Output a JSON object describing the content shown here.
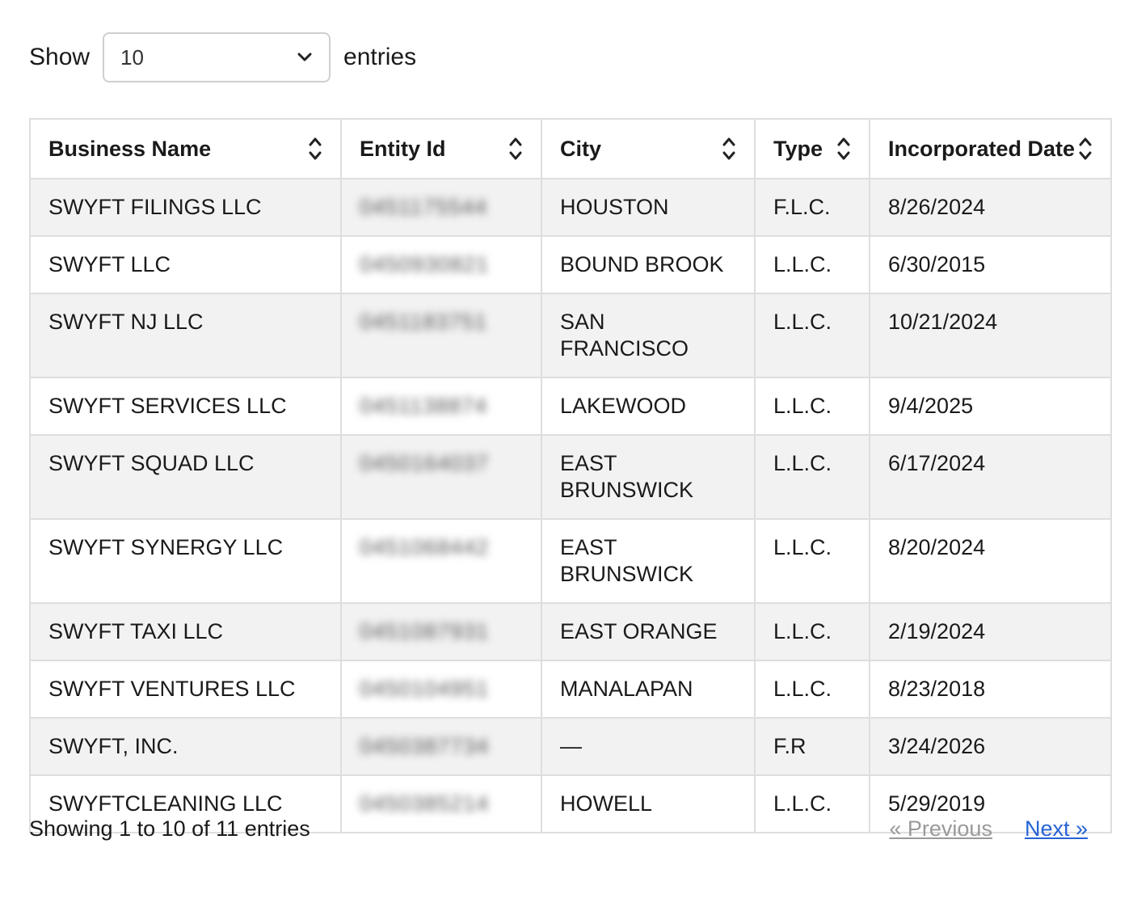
{
  "length_menu": {
    "show_label": "Show",
    "selected": "10",
    "entries_label": "entries"
  },
  "table": {
    "columns": [
      "Business Name",
      "Entity Id",
      "City",
      "Type",
      "Incorporated Date"
    ],
    "rows": [
      {
        "name": "SWYFT FILINGS LLC",
        "entity_id": "0451175544",
        "city": "HOUSTON",
        "type": "F.L.C.",
        "date": "8/26/2024"
      },
      {
        "name": "SWYFT LLC",
        "entity_id": "0450930821",
        "city": "BOUND BROOK",
        "type": "L.L.C.",
        "date": "6/30/2015"
      },
      {
        "name": "SWYFT NJ LLC",
        "entity_id": "0451183751",
        "city": "SAN FRANCISCO",
        "type": "L.L.C.",
        "date": "10/21/2024"
      },
      {
        "name": "SWYFT SERVICES LLC",
        "entity_id": "0451138874",
        "city": "LAKEWOOD",
        "type": "L.L.C.",
        "date": "9/4/2025"
      },
      {
        "name": "SWYFT SQUAD LLC",
        "entity_id": "0450164037",
        "city": "EAST BRUNSWICK",
        "type": "L.L.C.",
        "date": "6/17/2024"
      },
      {
        "name": "SWYFT SYNERGY LLC",
        "entity_id": "0451068442",
        "city": "EAST BRUNSWICK",
        "type": "L.L.C.",
        "date": "8/20/2024"
      },
      {
        "name": "SWYFT TAXI LLC",
        "entity_id": "0451087931",
        "city": "EAST ORANGE",
        "type": "L.L.C.",
        "date": "2/19/2024"
      },
      {
        "name": "SWYFT VENTURES LLC",
        "entity_id": "0450104951",
        "city": "MANALAPAN",
        "type": "L.L.C.",
        "date": "8/23/2018"
      },
      {
        "name": "SWYFT, INC.",
        "entity_id": "0450387734",
        "city": "—",
        "type": "F.R",
        "date": "3/24/2026"
      },
      {
        "name": "SWYFTCLEANING LLC",
        "entity_id": "0450385214",
        "city": "HOWELL",
        "type": "L.L.C.",
        "date": "5/29/2019"
      }
    ]
  },
  "info": "Showing 1 to 10 of 11 entries",
  "pagination": {
    "previous": "« Previous",
    "next": "Next »"
  }
}
